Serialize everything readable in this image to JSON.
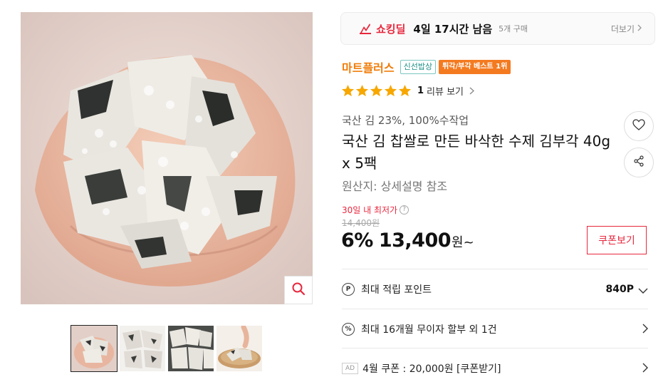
{
  "deal": {
    "brand": "쇼킹딜",
    "time_left": "4일 17시간 남음",
    "buy_count": "5개 구매",
    "more": "더보기",
    "brand_color": "#e8283e"
  },
  "seller": {
    "name": "마트플러스",
    "badge_fresh": "신선밥상",
    "badge_best": "튀각/부각 베스트 1위"
  },
  "rating": {
    "stars": 5,
    "review_count": "1",
    "review_label": "리뷰 보기"
  },
  "product": {
    "subtitle": "국산 김 23%, 100%수작업",
    "title": "국산 김 찹쌀로 만든 바삭한 수제 김부각 40g x 5팩",
    "origin": "원산지: 상세설명 참조"
  },
  "price": {
    "lowest_label": "30일 내 최저가",
    "original": "14,400원",
    "discount": "6%",
    "sale": "13,400",
    "unit": "원~",
    "coupon_button": "쿠폰보기"
  },
  "info_rows": {
    "points_label": "최대 적립 포인트",
    "points_value": "840P",
    "installment_label": "최대 16개월 무이자 할부 외 1건",
    "ad_tag": "AD",
    "coupon_label": "4월 쿠폰 : 20,000원 [쿠폰받기]"
  },
  "icons": {
    "deal": "lightning-icon",
    "wishlist": "heart-icon",
    "share": "share-icon",
    "zoom": "magnifier-icon",
    "points": "point-icon",
    "installment": "percent-icon"
  }
}
